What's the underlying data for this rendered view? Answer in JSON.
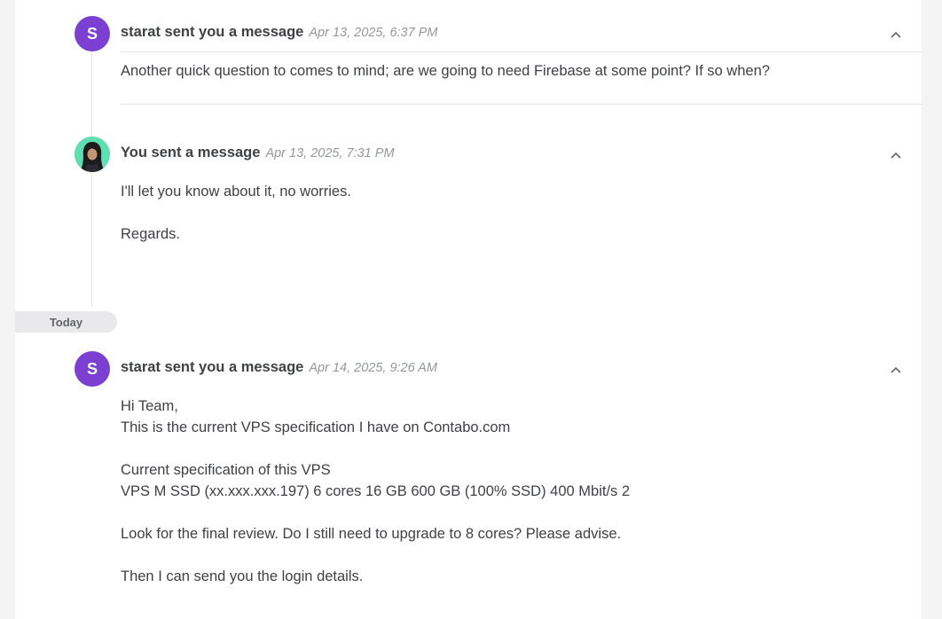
{
  "messages": [
    {
      "avatar_letter": "S",
      "sender": "starat sent you a message",
      "time": "Apr 13, 2025, 6:37 PM",
      "lines": [
        "Another quick question to comes to mind; are we going to need Firebase at some point? If so when?"
      ]
    },
    {
      "sender": "You sent a message",
      "time": "Apr 13, 2025, 7:31 PM",
      "lines": [
        "I'll let you know about it, no worries.",
        "Regards."
      ]
    },
    {
      "avatar_letter": "S",
      "sender": "starat sent you a message",
      "time": "Apr 14, 2025, 9:26 AM",
      "lines": [
        "Hi Team,",
        "This is the current VPS specification I have on Contabo.com",
        "Current specification of this VPS",
        "VPS M SSD (xx.xxx.xxx.197) 6 cores 16 GB 600 GB (100% SSD) 400 Mbit/s 2",
        "Look for the final review. Do I still need to upgrade to 8 cores? Please advise.",
        "Then I can send you the login details."
      ]
    }
  ],
  "divider_label": "Today",
  "icons": {
    "collapse": "chevron-up-icon",
    "avatar_photo": "user-avatar-photo"
  },
  "colors": {
    "avatar_purple": "#7b3fd1",
    "avatar_photo_bg": "#5fdfb0"
  }
}
